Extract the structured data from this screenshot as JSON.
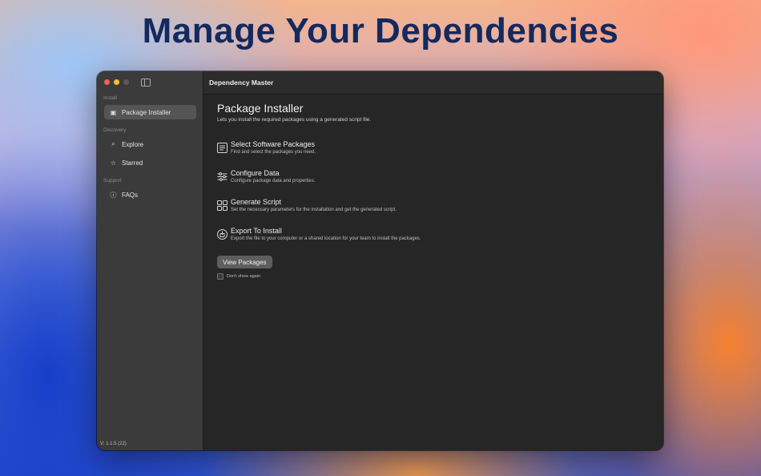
{
  "headline": "Manage Your Dependencies",
  "window": {
    "title": "Dependency Master"
  },
  "sidebar": {
    "sections": [
      {
        "title": "Install",
        "items": [
          {
            "label": "Package Installer",
            "icon": "box-icon",
            "active": true
          }
        ]
      },
      {
        "title": "Discovery",
        "items": [
          {
            "label": "Explore",
            "icon": "magnifier-icon"
          },
          {
            "label": "Starred",
            "icon": "star-icon"
          }
        ]
      },
      {
        "title": "Support",
        "items": [
          {
            "label": "FAQs",
            "icon": "info-circle-icon"
          }
        ]
      }
    ],
    "version": "V: 1.1.5 (22)"
  },
  "main": {
    "title": "Package Installer",
    "subtitle": "Lets you install the required packages using a generated script file.",
    "steps": [
      {
        "title": "Select Software Packages",
        "desc": "Find and select the packages you need.",
        "icon": "list-icon"
      },
      {
        "title": "Configure Data",
        "desc": "Configure package data and properties.",
        "icon": "sliders-icon"
      },
      {
        "title": "Generate Script",
        "desc": "Set the necessary parameters for the installation and get the generated script.",
        "icon": "grid-icon"
      },
      {
        "title": "Export To Install",
        "desc": "Export the file to your computer or a shared location for your team to install the packages.",
        "icon": "export-icon"
      }
    ],
    "button_label": "View Packages",
    "checkbox_label": "Don't show again",
    "checkbox_checked": false
  },
  "colors": {
    "headline": "#14295e",
    "sidebar_bg": "#3b3b3b",
    "main_bg": "#262626",
    "active_item_bg": "#555555",
    "button_bg": "#5e5e5e"
  }
}
